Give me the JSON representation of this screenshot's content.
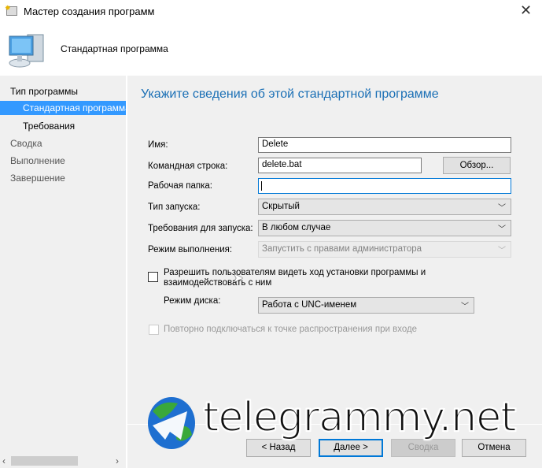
{
  "window": {
    "title": "Мастер создания программ"
  },
  "header": {
    "title": "Стандартная программа"
  },
  "sidebar": {
    "items": [
      {
        "label": "Тип программы"
      },
      {
        "label": "Стандартная программа",
        "selected": true
      },
      {
        "label": "Требования"
      },
      {
        "label": "Сводка"
      },
      {
        "label": "Выполнение"
      },
      {
        "label": "Завершение"
      }
    ]
  },
  "main": {
    "heading": "Укажите сведения об этой стандартной программе",
    "name_label": "Имя:",
    "name_value": "Delete",
    "cmd_label": "Командная строка:",
    "cmd_value": "delete.bat",
    "browse": "Обзор...",
    "folder_label": "Рабочая папка:",
    "folder_value": "",
    "run_label": "Тип запуска:",
    "run_value": "Скрытый",
    "req_label": "Требования для запуска:",
    "req_value": "В любом случае",
    "mode_label": "Режим выполнения:",
    "mode_value": "Запустить с правами администратора",
    "allow_label": "Разрешить пользователям видеть ход установки программы и взаимодействовать с ним",
    "allow_checked": false,
    "disk_label": "Режим диска:",
    "disk_value": "Работа с UNC-именем",
    "reconnect_label": "Повторно подключаться к точке распространения при входе",
    "reconnect_checked": false
  },
  "buttons": {
    "back": "< Назад",
    "next": "Далее >",
    "summary": "Сводка",
    "cancel": "Отмена"
  },
  "watermark": {
    "text": "telegrammy.net"
  },
  "colors": {
    "accent": "#1a6fb5",
    "selection": "#3399ff"
  }
}
